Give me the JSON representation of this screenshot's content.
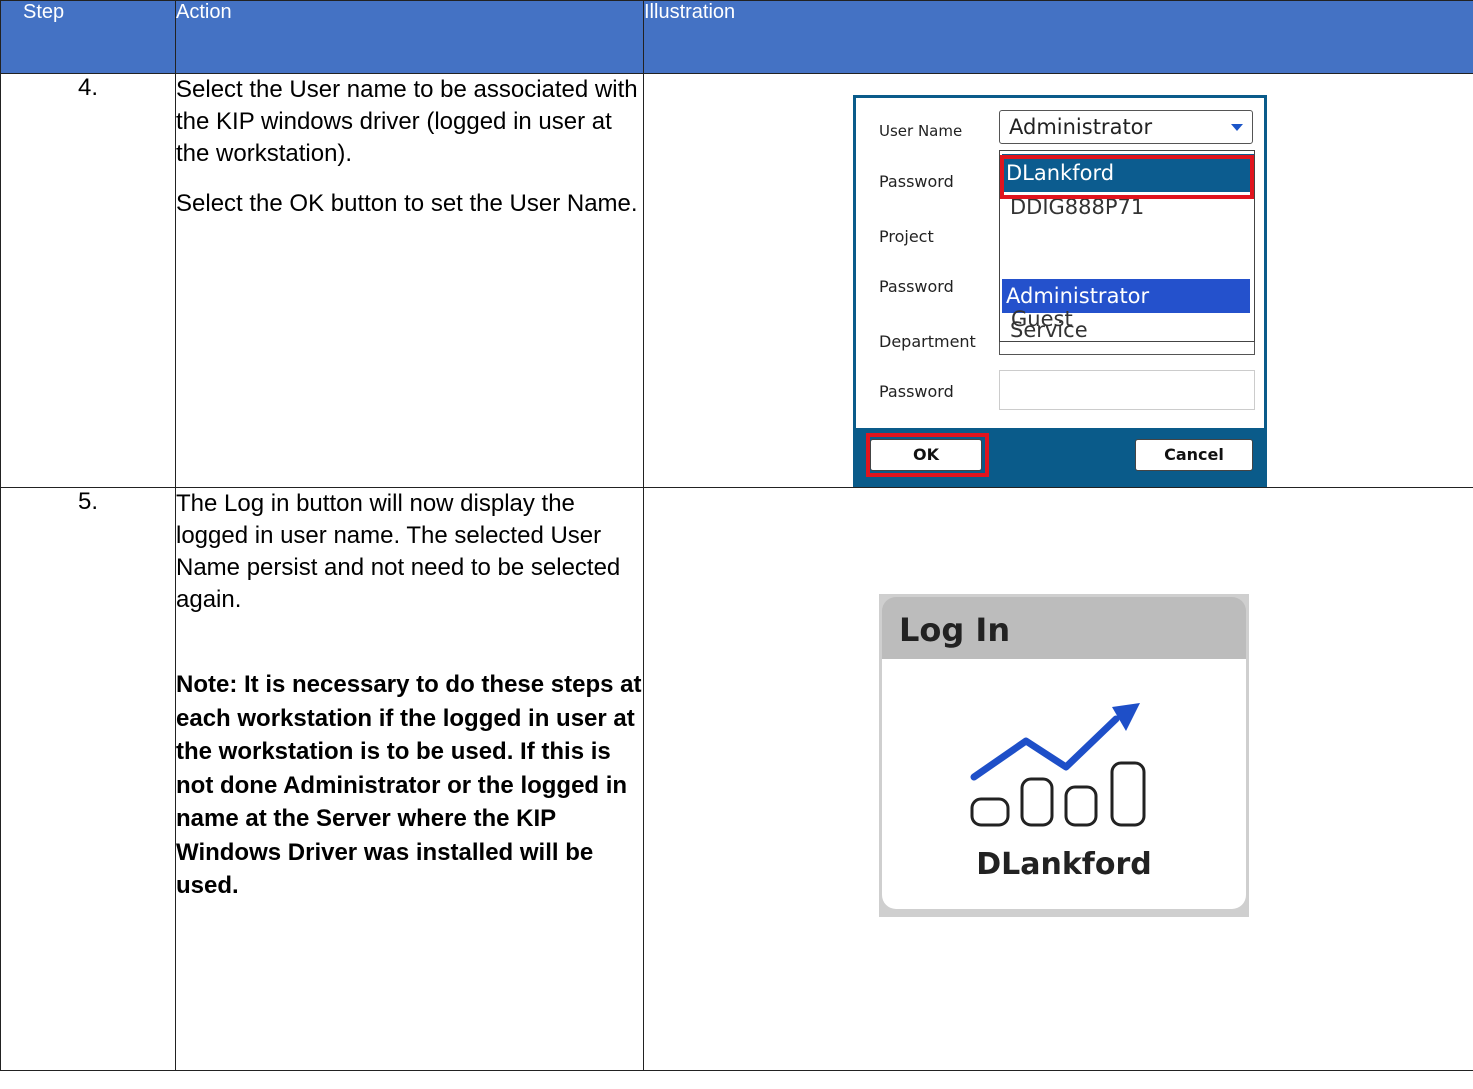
{
  "header": {
    "step": "Step",
    "action": "Action",
    "illustration": "Illustration"
  },
  "rows": [
    {
      "step": "4.",
      "action_p1": "Select the User name to be associated with the KIP windows driver (logged in user at the workstation).",
      "action_p2": "Select the OK button to set the User Name."
    },
    {
      "step": "5.",
      "action_p1": "The Log in button will now display the logged in user name. The selected User Name persist and not need to be selected again.",
      "note": "Note: It is necessary to do these steps at each workstation if the logged in user at the workstation is to be used. If this is not done Administrator or the logged in name at the Server where the KIP Windows Driver was installed will be used."
    }
  ],
  "dialog": {
    "labels": {
      "user_name": "User Name",
      "password1": "Password",
      "project": "Project",
      "password2": "Password",
      "department": "Department",
      "password3": "Password"
    },
    "user_name_value": "Administrator",
    "dropdown_items": [
      "DLankford",
      "DDIG888P71",
      "Administrator",
      "Service",
      "Guest"
    ],
    "hovered_item": "DLankford",
    "selected_item": "Administrator",
    "ok_label": "OK",
    "cancel_label": "Cancel",
    "dialog_color": "#0a5b8a",
    "highlight_color": "#e0141e"
  },
  "login_tile": {
    "title": "Log In",
    "user": "DLankford",
    "icon": "chart-trend-up-icon",
    "accent": "#1e4fc8"
  },
  "colors": {
    "header_bg": "#4472c4"
  }
}
